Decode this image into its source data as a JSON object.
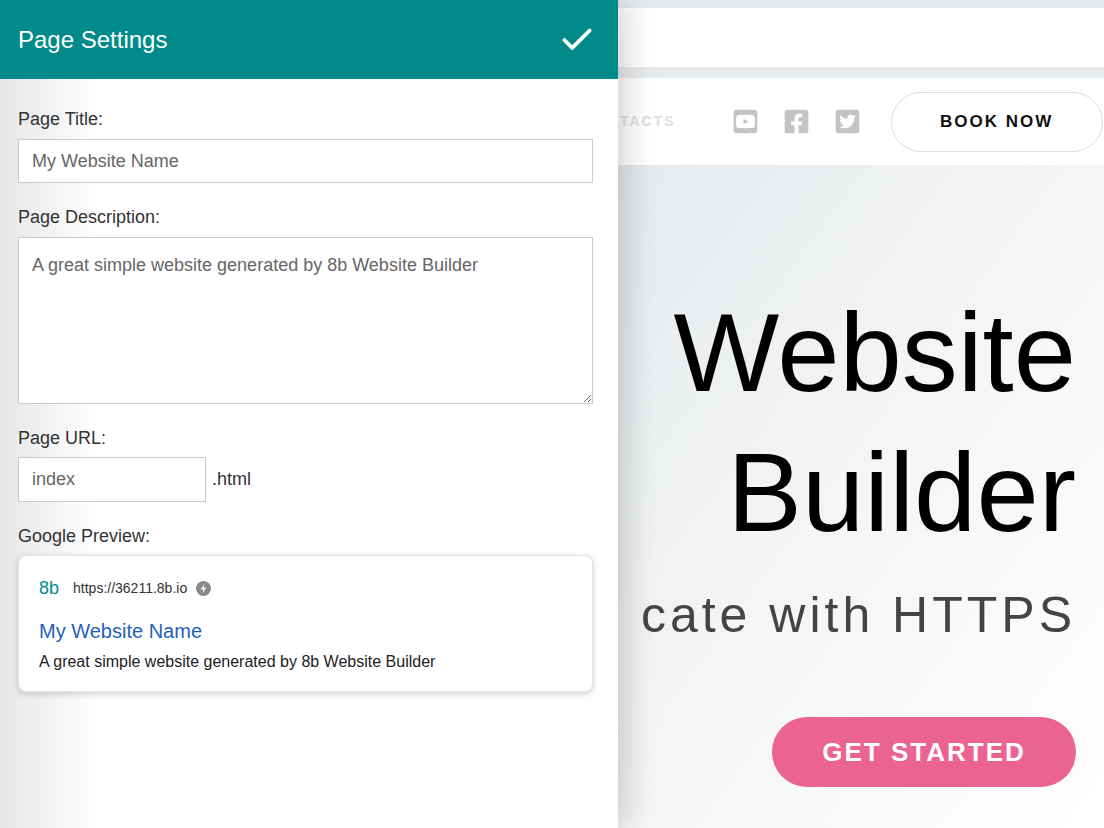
{
  "page_settings": {
    "title": "Page Settings",
    "page_title": {
      "label": "Page Title:",
      "value": "My Website Name"
    },
    "page_description": {
      "label": "Page Description:",
      "value": "A great simple website generated by 8b Website Builder"
    },
    "page_url": {
      "label": "Page URL:",
      "value": "index",
      "suffix": ".html"
    },
    "google_preview": {
      "label": "Google Preview:",
      "favicon": "8b",
      "url": "https://36211.8b.io",
      "title": "My Website Name",
      "description": "A great simple website generated by 8b Website Builder"
    }
  },
  "site_preview": {
    "nav": {
      "partial_link": "TACTS",
      "book_button": "BOOK NOW"
    },
    "hero": {
      "title_lines": [
        "Website",
        "Builder"
      ],
      "subtitle": "cate with HTTPS",
      "button": "GET STARTED"
    }
  }
}
